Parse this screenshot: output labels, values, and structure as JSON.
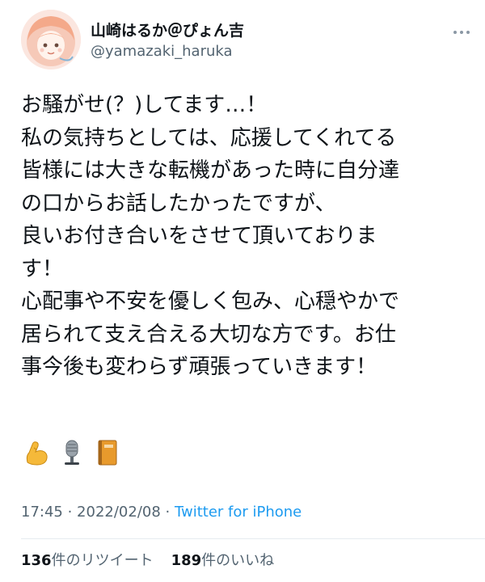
{
  "user": {
    "display_name": "山崎はるか＠ぴょん吉",
    "handle": "@yamazaki_haruka"
  },
  "tweet": {
    "lines": [
      "お騒がせ(？)してます…！",
      "私の気持ちとしては、応援してくれてる",
      "皆様には大きな転機があった時に自分達",
      "の口からお話したかったですが、",
      "良いお付き合いをさせて頂いておりま",
      "す！",
      "心配事や不安を優しく包み、心穏やかで",
      "居られて支え合える大切な方です。お仕",
      "事今後も変わらず頑張っていきます！"
    ],
    "emojis": [
      "flexed-biceps",
      "studio-microphone",
      "notebook"
    ]
  },
  "meta": {
    "time": "17:45",
    "separator": " · ",
    "date": "2022/02/08",
    "separator2": " · ",
    "source": "Twitter for iPhone"
  },
  "stats": {
    "retweets_count": "136",
    "retweets_label": "件のリツイート",
    "likes_count": "189",
    "likes_label": "件のいいね"
  },
  "colors": {
    "link": "#1d9bf0",
    "secondary": "#536471",
    "primary": "#0f1419"
  }
}
